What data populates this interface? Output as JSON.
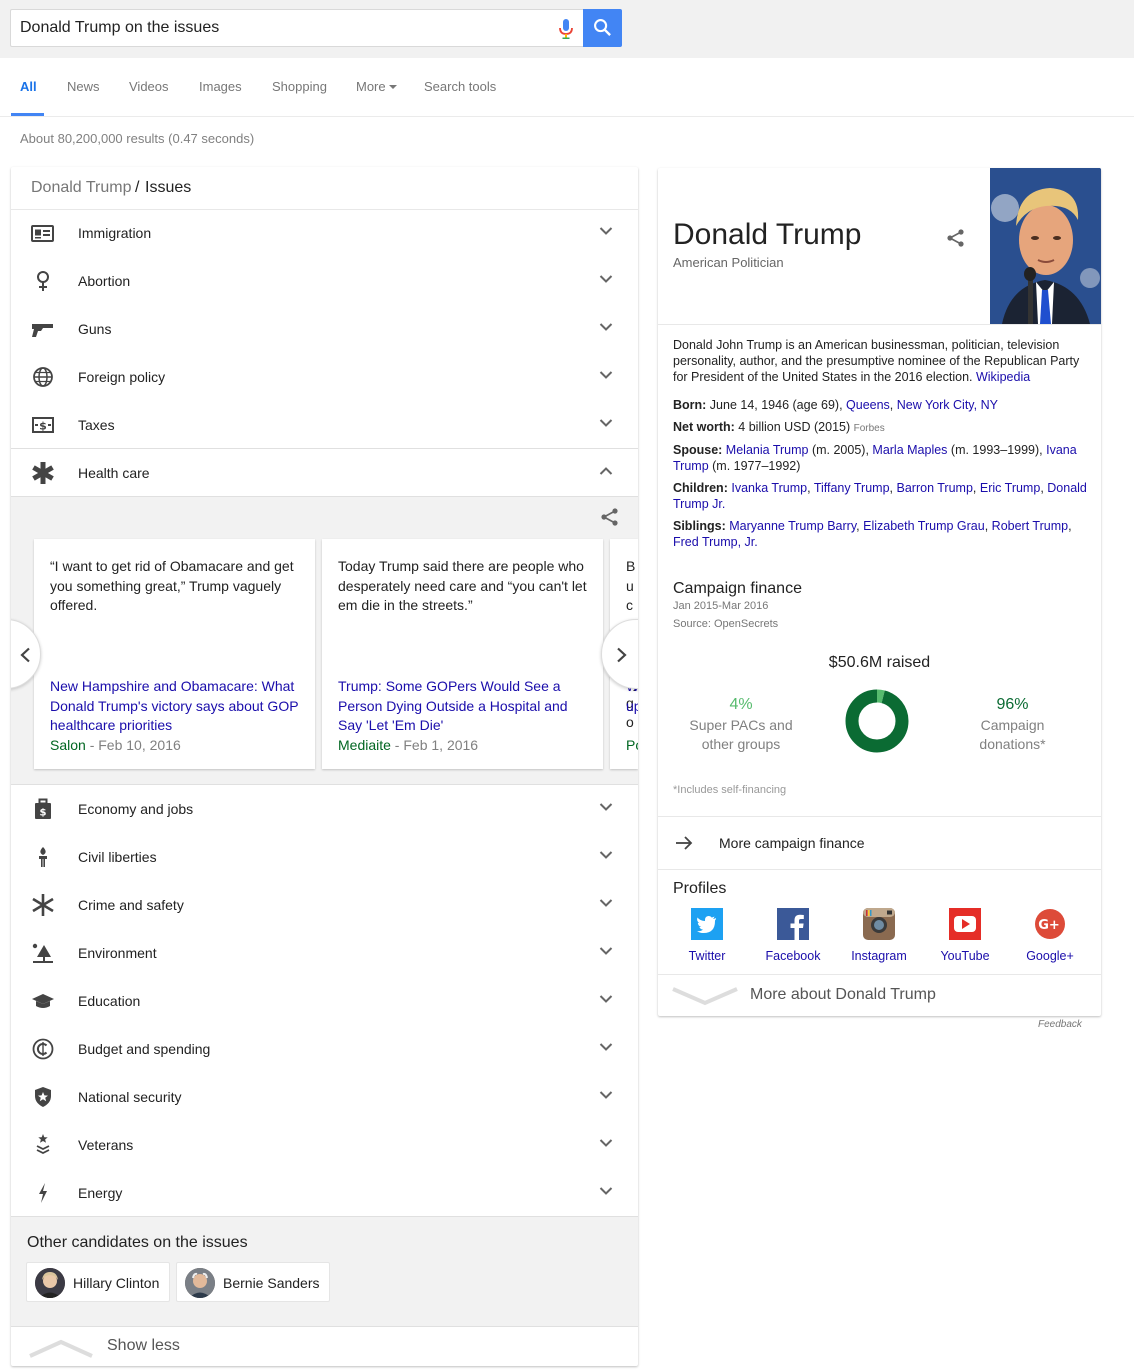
{
  "search": {
    "query": "Donald Trump on the issues"
  },
  "tabs": [
    {
      "label": "All"
    },
    {
      "label": "News"
    },
    {
      "label": "Videos"
    },
    {
      "label": "Images"
    },
    {
      "label": "Shopping"
    },
    {
      "label": "More"
    },
    {
      "label": "Search tools"
    }
  ],
  "stats": "About 80,200,000 results (0.47 seconds)",
  "issues_card": {
    "crumb_parent": "Donald Trump",
    "crumb_sep": "/",
    "crumb_current": "Issues",
    "issues_top": [
      {
        "label": "Immigration",
        "icon": "id-card-icon"
      },
      {
        "label": "Abortion",
        "icon": "female-symbol-icon"
      },
      {
        "label": "Guns",
        "icon": "gun-icon"
      },
      {
        "label": "Foreign policy",
        "icon": "globe-icon"
      },
      {
        "label": "Taxes",
        "icon": "money-icon"
      },
      {
        "label": "Health care",
        "icon": "medical-star-icon"
      }
    ],
    "health_care_news": [
      {
        "quote": "“I want to get rid of Obamacare and get you something great,” Trump vaguely offered.",
        "headline": "New Hampshire and Obamacare: What Donald Trump's victory says about GOP healthcare priorities",
        "site": "Salon",
        "date": " - Feb 10, 2016"
      },
      {
        "quote": "Today Trump said there are people who desperately need care and “you can't let em die in the streets.”",
        "headline": "Trump: Some GOPers Would See a Person Dying Outside a Hospital and Say 'Let 'Em Die'",
        "site": "Mediaite",
        "date": " - Feb 1, 2016"
      },
      {
        "quote": "Bu co sc cl sy go",
        "headline": "W up",
        "site": "Pc",
        "date": ""
      }
    ],
    "issues_bottom": [
      {
        "label": "Economy and jobs",
        "icon": "briefcase-icon"
      },
      {
        "label": "Civil liberties",
        "icon": "torch-icon"
      },
      {
        "label": "Crime and safety",
        "icon": "asterisk-icon"
      },
      {
        "label": "Environment",
        "icon": "tree-icon"
      },
      {
        "label": "Education",
        "icon": "graduation-cap-icon"
      },
      {
        "label": "Budget and spending",
        "icon": "copyright-coin-icon"
      },
      {
        "label": "National security",
        "icon": "shield-star-icon"
      },
      {
        "label": "Veterans",
        "icon": "star-chevron-icon"
      },
      {
        "label": "Energy",
        "icon": "bolt-icon"
      }
    ],
    "other_candidates_title": "Other candidates on the issues",
    "other_candidates": [
      {
        "name": "Hillary Clinton"
      },
      {
        "name": "Bernie Sanders"
      }
    ],
    "show_less": "Show less"
  },
  "knowledge_panel": {
    "title": "Donald Trump",
    "subtitle": "American Politician",
    "description": "Donald John Trump is an American businessman, politician, television personality, author, and the presumptive nominee of the Republican Party for President of the United States in the 2016 election.",
    "description_link": "Wikipedia",
    "born_label": "Born:",
    "born_text": " June 14, 1946 (age 69), ",
    "born_link1": "Queens",
    "born_comma": ", ",
    "born_link2": "New York City, NY",
    "networth_label": "Net worth:",
    "networth_text": " 4 billion USD (2015) ",
    "networth_source": "Forbes",
    "spouse_label": "Spouse:",
    "spouse_link1": "Melania Trump",
    "spouse_text1": " (m. 2005), ",
    "spouse_link2": "Marla Maples",
    "spouse_text2": " (m. 1993–1999), ",
    "spouse_link3": "Ivana Trump",
    "spouse_text3": " (m. 1977–1992)",
    "children_label": "Children:",
    "children_link1": "Ivanka Trump",
    "children_link2": "Tiffany Trump",
    "children_link3": "Barron Trump",
    "children_link4": "Eric Trump",
    "children_link5": "Donald Trump Jr.",
    "siblings_label": "Siblings:",
    "siblings_link1": "Maryanne Trump Barry",
    "siblings_link2": "Elizabeth Trump Grau",
    "siblings_link3": "Robert Trump",
    "siblings_link4": "Fred Trump, Jr.",
    "comma": ", ",
    "campaign": {
      "title": "Campaign finance",
      "date_range": "Jan 2015-Mar 2016",
      "source": "Source: OpenSecrets",
      "raised": "$50.6M raised",
      "left_pct": "4%",
      "left_label": "Super PACs and other groups",
      "right_pct": "96%",
      "right_label": "Campaign donations*",
      "note": "*Includes self-financing",
      "more": "More campaign finance",
      "shares": [
        {
          "value": 4,
          "color": "#57bb6e"
        },
        {
          "value": 96,
          "color": "#0b6b33"
        }
      ]
    },
    "profiles_title": "Profiles",
    "profiles": [
      {
        "name": "Twitter",
        "icon": "twitter-icon"
      },
      {
        "name": "Facebook",
        "icon": "facebook-icon"
      },
      {
        "name": "Instagram",
        "icon": "instagram-icon"
      },
      {
        "name": "YouTube",
        "icon": "youtube-icon"
      },
      {
        "name": "Google+",
        "icon": "google-plus-icon"
      }
    ],
    "more_about": "More about Donald Trump"
  },
  "feedback": "Feedback",
  "colors": {
    "accent": "#4285f4",
    "link": "#1a0dab",
    "source_green": "#006621"
  }
}
